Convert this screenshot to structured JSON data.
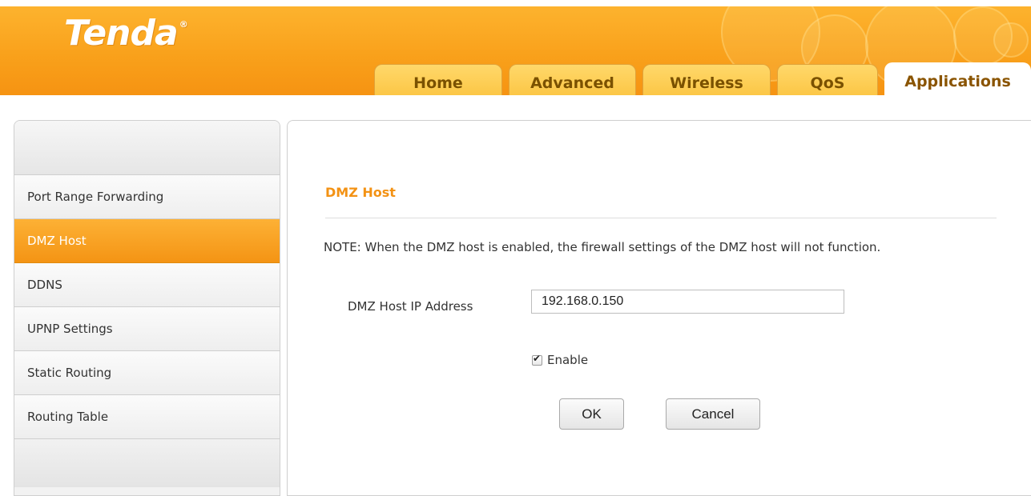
{
  "brand": {
    "logo_text": "Tenda",
    "registered_mark": "®"
  },
  "nav": {
    "tabs": [
      {
        "label": "Home"
      },
      {
        "label": "Advanced"
      },
      {
        "label": "Wireless"
      },
      {
        "label": "QoS"
      },
      {
        "label": "Applications",
        "active": true
      }
    ]
  },
  "sidebar": {
    "items": [
      {
        "label": "Port Range Forwarding"
      },
      {
        "label": "DMZ Host",
        "active": true
      },
      {
        "label": "DDNS"
      },
      {
        "label": "UPNP Settings"
      },
      {
        "label": "Static Routing"
      },
      {
        "label": "Routing Table"
      }
    ]
  },
  "main": {
    "title": "DMZ Host",
    "note": "NOTE: When the DMZ host is enabled, the firewall settings of the DMZ host will not function.",
    "ip_label": "DMZ Host IP Address",
    "ip_value": "192.168.0.150",
    "enable_label": "Enable",
    "enable_checked": true,
    "ok_label": "OK",
    "cancel_label": "Cancel"
  },
  "colors": {
    "header_orange": "#f9a11b",
    "tab_yellow": "#fbc33f",
    "active_item_orange": "#f49414",
    "title_orange": "#f39214"
  }
}
